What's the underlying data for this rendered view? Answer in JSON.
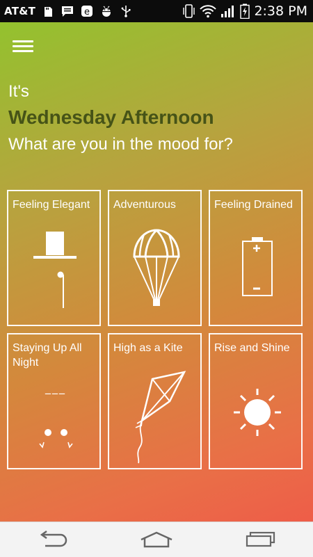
{
  "status_bar": {
    "carrier": "AT&T",
    "time": "2:38 PM",
    "icons": [
      "sd-card-icon",
      "message-icon",
      "e-icon",
      "android-debug-icon",
      "usb-icon",
      "vibrate-icon",
      "wifi-icon",
      "signal-icon",
      "battery-charging-icon"
    ]
  },
  "greeting": {
    "prefix": "It's",
    "time_of_day": "Wednesday Afternoon",
    "question": "What are you in the mood for?"
  },
  "moods": [
    {
      "label": "Feeling Elegant",
      "icon": "top-hat-icon"
    },
    {
      "label": "Adventurous",
      "icon": "parachute-icon"
    },
    {
      "label": "Feeling Drained",
      "icon": "battery-icon"
    },
    {
      "label": "Staying Up All Night",
      "icon": "sleepy-face-icon",
      "face_text": "___"
    },
    {
      "label": "High as a Kite",
      "icon": "kite-icon"
    },
    {
      "label": "Rise and Shine",
      "icon": "sun-icon"
    }
  ],
  "colors": {
    "gradient_start": "#93c22e",
    "gradient_end": "#ee5d48",
    "title_dark": "#465317"
  },
  "nav": [
    "back-icon",
    "home-icon",
    "recent-apps-icon"
  ]
}
